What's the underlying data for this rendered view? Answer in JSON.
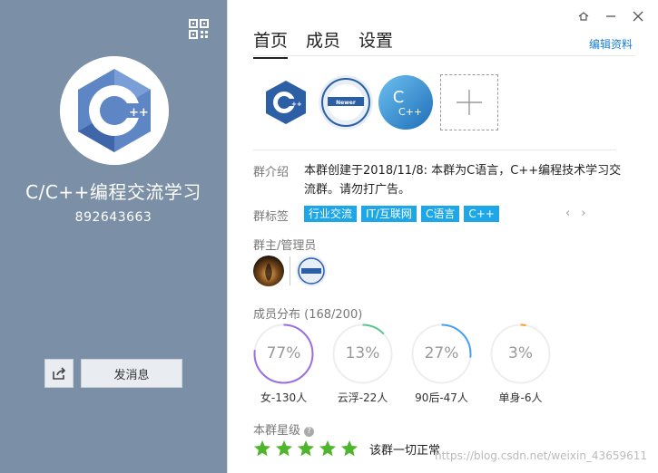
{
  "left": {
    "group_name": "C/C++编程交流学习",
    "group_id": "892643663",
    "send_msg_label": "发消息",
    "bg_color": "#7b8fa6"
  },
  "window": {
    "icons": [
      "settings-icon",
      "minimize-icon",
      "close-icon"
    ]
  },
  "tabs": [
    {
      "label": "首页",
      "active": true
    },
    {
      "label": "成员",
      "active": false
    },
    {
      "label": "设置",
      "active": false
    }
  ],
  "edit_link": "编辑资料",
  "intro": {
    "label": "群介绍",
    "text": "本群创建于2018/11/8: 本群为C语言，C++编程技术学习交流群。请勿打广告。"
  },
  "tags": {
    "label": "群标签",
    "items": [
      "行业交流",
      "IT/互联网",
      "C语言",
      "C++"
    ]
  },
  "admins": {
    "label": "群主/管理员"
  },
  "distribution": {
    "label": "成员分布 (168/200)",
    "items": [
      {
        "pct": "77%",
        "caption": "女-130人",
        "value": 0.77,
        "color": "#9b6fe0"
      },
      {
        "pct": "13%",
        "caption": "云浮-22人",
        "value": 0.13,
        "color": "#53c98f"
      },
      {
        "pct": "27%",
        "caption": "90后-47人",
        "value": 0.27,
        "color": "#4a9ff5"
      },
      {
        "pct": "3%",
        "caption": "单身-6人",
        "value": 0.03,
        "color": "#f5a030"
      }
    ]
  },
  "rating": {
    "label": "本群星级",
    "help": "?",
    "stars": 5,
    "status_text": "该群一切正常"
  },
  "watermark": "https://blog.csdn.net/weixin_43659611"
}
